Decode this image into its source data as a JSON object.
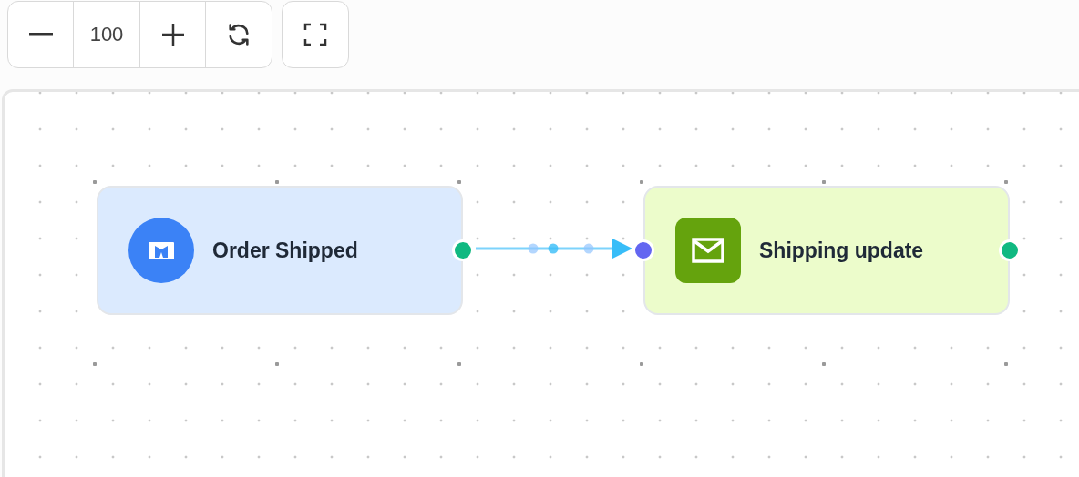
{
  "toolbar": {
    "zoom_value": "100"
  },
  "nodes": [
    {
      "label": "Order Shipped",
      "kind": "trigger",
      "color": "#dbeafe",
      "input_port": false,
      "output_port": true
    },
    {
      "label": "Shipping update",
      "kind": "action",
      "color": "#ecfccb",
      "input_port": true,
      "output_port": true
    }
  ],
  "edges": [
    {
      "kind": "arrow"
    }
  ]
}
